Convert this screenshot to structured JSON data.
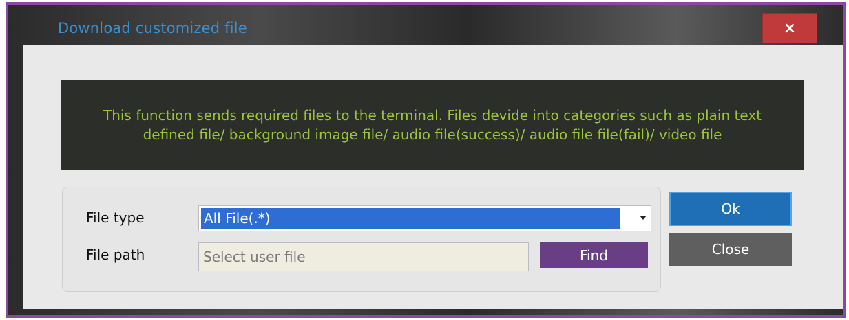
{
  "window": {
    "title": "Download customized file",
    "close_glyph": "×",
    "frame_color": "#8a4aa3",
    "close_color": "#c0393b"
  },
  "info": {
    "line1": "This function sends required files to the terminal. Files devide into categories such as plain text",
    "line2": "defined file/ background image file/ audio file(success)/ audio file file(fail)/ video file",
    "text_color": "#9ac53a"
  },
  "form": {
    "file_type_label": "File type",
    "file_type_value": "All File(.*)",
    "file_path_label": "File path",
    "file_path_placeholder": "Select user file",
    "find_label": "Find"
  },
  "buttons": {
    "ok_label": "Ok",
    "close_label": "Close"
  },
  "icons": {
    "dropdown": "chevron-down-icon",
    "close": "close-icon"
  }
}
